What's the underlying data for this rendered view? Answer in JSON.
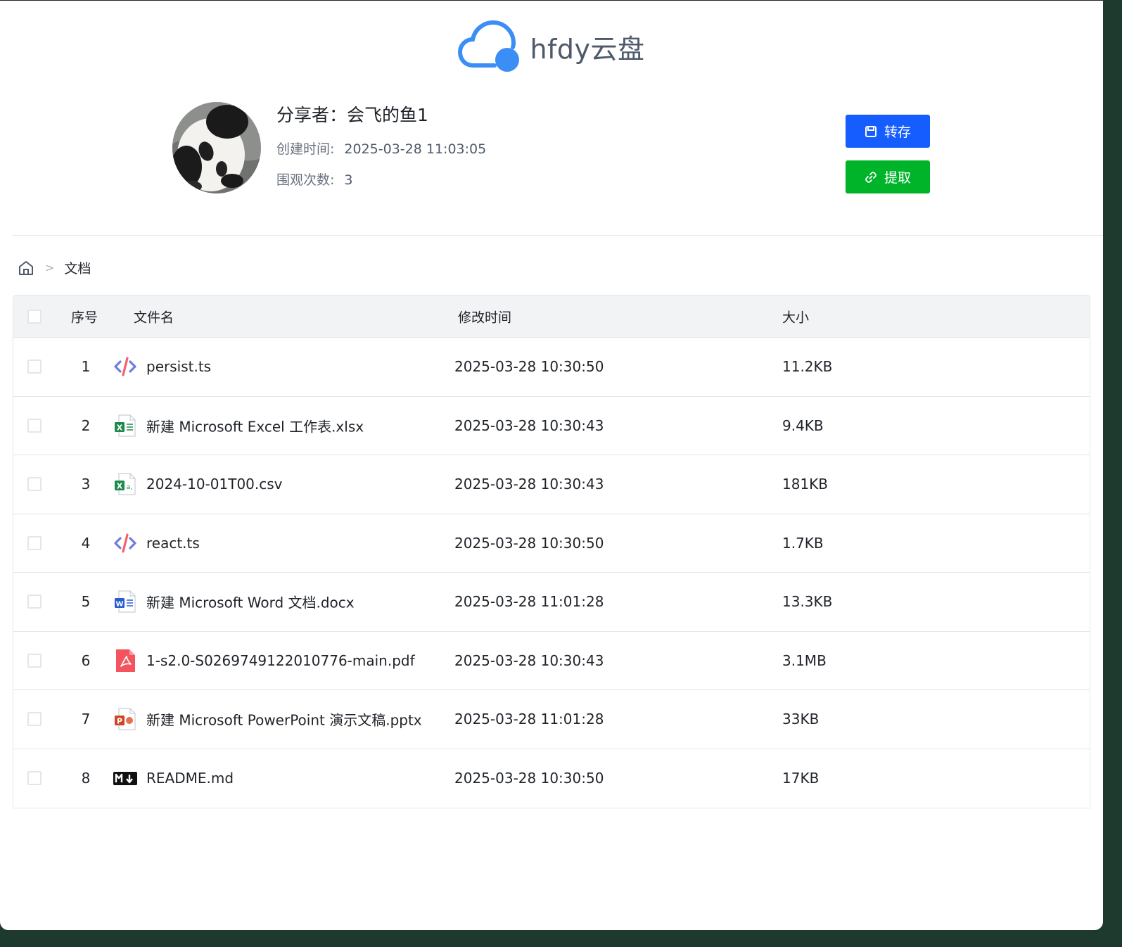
{
  "app": {
    "name": "hfdy云盘"
  },
  "share": {
    "sharer_label": "分享者：会飞的鱼1",
    "created_label": "创建时间:",
    "created_value": "2025-03-28 11:03:05",
    "views_label": "围观次数:",
    "views_value": "3"
  },
  "actions": {
    "save_label": "转存",
    "extract_label": "提取"
  },
  "breadcrumb": {
    "current": "文档",
    "separator": ">"
  },
  "table": {
    "headers": {
      "index": "序号",
      "name": "文件名",
      "modified": "修改时间",
      "size": "大小"
    },
    "rows": [
      {
        "index": "1",
        "icon": "code-file-icon",
        "name": "persist.ts",
        "modified": "2025-03-28 10:30:50",
        "size": "11.2KB"
      },
      {
        "index": "2",
        "icon": "excel-file-icon",
        "name": "新建 Microsoft Excel 工作表.xlsx",
        "modified": "2025-03-28 10:30:43",
        "size": "9.4KB"
      },
      {
        "index": "3",
        "icon": "csv-file-icon",
        "name": "2024-10-01T00.csv",
        "modified": "2025-03-28 10:30:43",
        "size": "181KB"
      },
      {
        "index": "4",
        "icon": "code-file-icon",
        "name": "react.ts",
        "modified": "2025-03-28 10:30:50",
        "size": "1.7KB"
      },
      {
        "index": "5",
        "icon": "word-file-icon",
        "name": "新建 Microsoft Word 文档.docx",
        "modified": "2025-03-28 11:01:28",
        "size": "13.3KB"
      },
      {
        "index": "6",
        "icon": "pdf-file-icon",
        "name": "1-s2.0-S0269749122010776-main.pdf",
        "modified": "2025-03-28 10:30:43",
        "size": "3.1MB"
      },
      {
        "index": "7",
        "icon": "powerpoint-file-icon",
        "name": "新建 Microsoft PowerPoint 演示文稿.pptx",
        "modified": "2025-03-28 11:01:28",
        "size": "33KB"
      },
      {
        "index": "8",
        "icon": "markdown-file-icon",
        "name": "README.md",
        "modified": "2025-03-28 10:30:50",
        "size": "17KB"
      }
    ]
  },
  "colors": {
    "primary": "#165dff",
    "success": "#00b42a",
    "logo_blue": "#3a8ef6"
  }
}
